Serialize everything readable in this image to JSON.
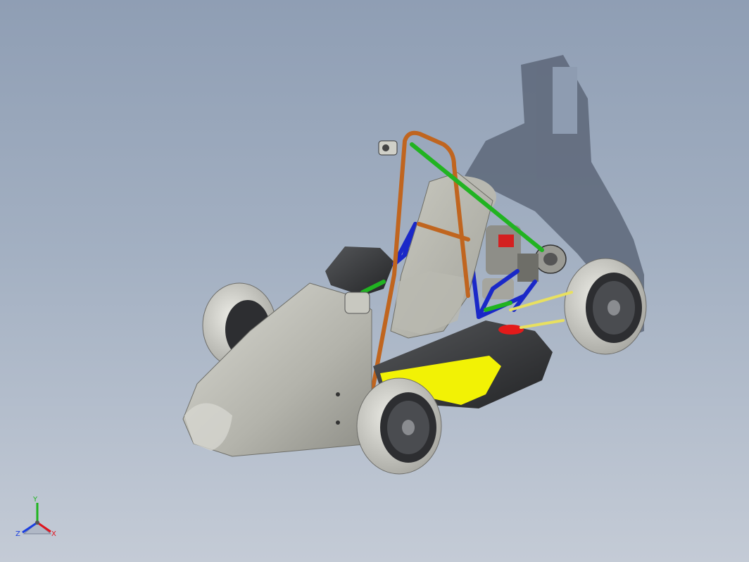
{
  "viewport": {
    "background_top": "#8f9eb4",
    "background_bottom": "#c4cbd6"
  },
  "model": {
    "body_color": "#bdbdb5",
    "sidepod_color": "#3a3b3d",
    "accent_color": "#f2f205",
    "roll_hoop_color": "#c0651f",
    "frame_color": "#1a28c8",
    "brace_color": "#21b321",
    "tire_color": "#d5d5cf",
    "rim_color": "#5a5c60"
  },
  "triad": {
    "x_label": "X",
    "y_label": "Y",
    "z_label": "Z",
    "x_color": "#e0141e",
    "y_color": "#1fb41f",
    "z_color": "#1a3ee0"
  }
}
